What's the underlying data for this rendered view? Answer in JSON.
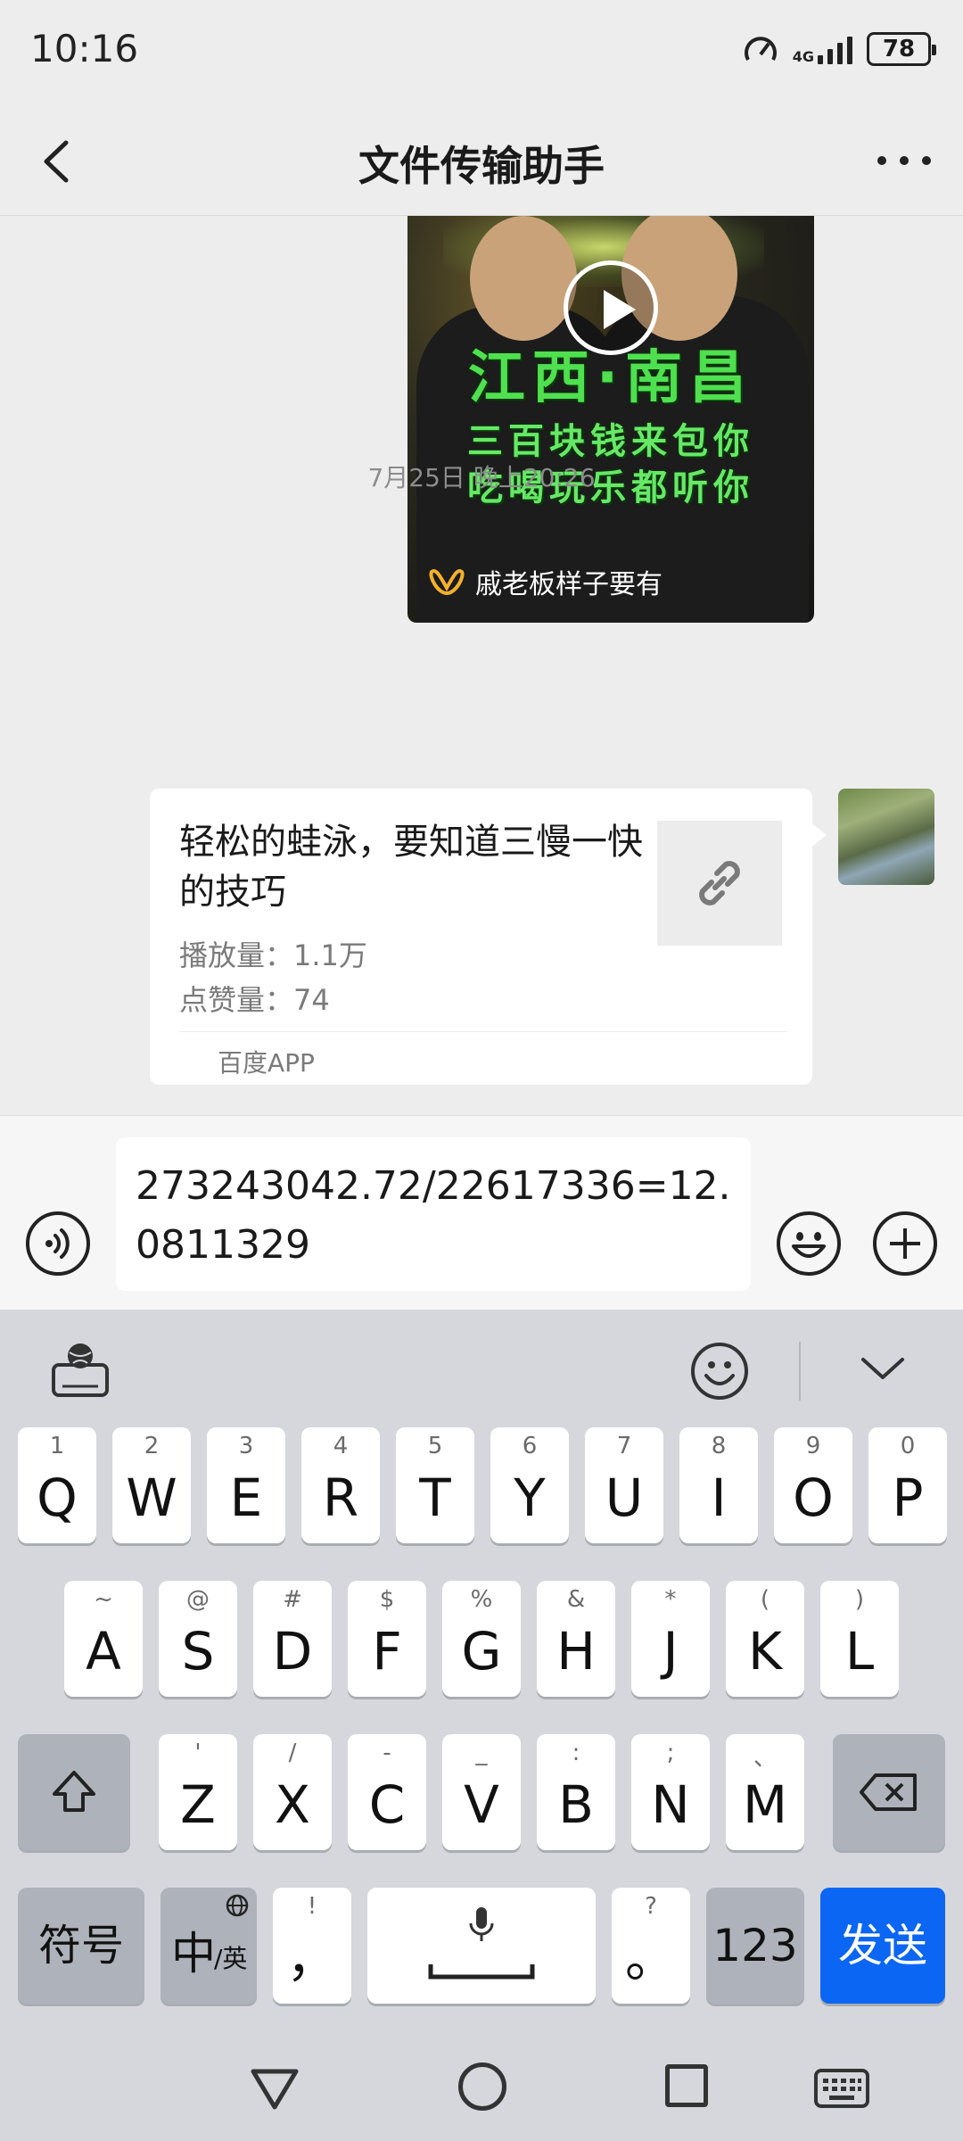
{
  "status_bar": {
    "time": "10:16",
    "network": "4G",
    "battery": "78"
  },
  "header": {
    "title": "文件传输助手"
  },
  "video_message": {
    "headline": "江西·南昌",
    "line1": "三百块钱来包你",
    "line2": "吃喝玩乐都听你",
    "author": "戚老板样子要有"
  },
  "timestamp": "7月25日 晚上20:26",
  "link_message": {
    "title": "轻松的蛙泳，要知道三慢一快的技巧",
    "views": "播放量：1.1万",
    "likes": "点赞量：74",
    "source": "百度APP"
  },
  "input": {
    "text": "273243042.72/22617336=12.0811329"
  },
  "keyboard": {
    "row1": [
      {
        "main": "Q",
        "sub": "1"
      },
      {
        "main": "W",
        "sub": "2"
      },
      {
        "main": "E",
        "sub": "3"
      },
      {
        "main": "R",
        "sub": "4"
      },
      {
        "main": "T",
        "sub": "5"
      },
      {
        "main": "Y",
        "sub": "6"
      },
      {
        "main": "U",
        "sub": "7"
      },
      {
        "main": "I",
        "sub": "8"
      },
      {
        "main": "O",
        "sub": "9"
      },
      {
        "main": "P",
        "sub": "0"
      }
    ],
    "row2": [
      {
        "main": "A",
        "sub": "~"
      },
      {
        "main": "S",
        "sub": "@"
      },
      {
        "main": "D",
        "sub": "#"
      },
      {
        "main": "F",
        "sub": "$"
      },
      {
        "main": "G",
        "sub": "%"
      },
      {
        "main": "H",
        "sub": "&"
      },
      {
        "main": "J",
        "sub": "*"
      },
      {
        "main": "K",
        "sub": "("
      },
      {
        "main": "L",
        "sub": ")"
      }
    ],
    "row3": [
      {
        "main": "Z",
        "sub": "'"
      },
      {
        "main": "X",
        "sub": "/"
      },
      {
        "main": "C",
        "sub": "-"
      },
      {
        "main": "V",
        "sub": "_"
      },
      {
        "main": "B",
        "sub": ":"
      },
      {
        "main": "N",
        "sub": ";"
      },
      {
        "main": "M",
        "sub": "、"
      }
    ],
    "symbols_label": "符号",
    "lang_main": "中",
    "lang_sub": "/英",
    "comma_main": "，",
    "comma_sub": "!",
    "period_main": "。",
    "period_sub": "?",
    "num_label": "123",
    "send_label": "发送"
  },
  "colors": {
    "send": "#0a66f3",
    "background": "#ededed",
    "keyboard": "#d5d7dc"
  }
}
